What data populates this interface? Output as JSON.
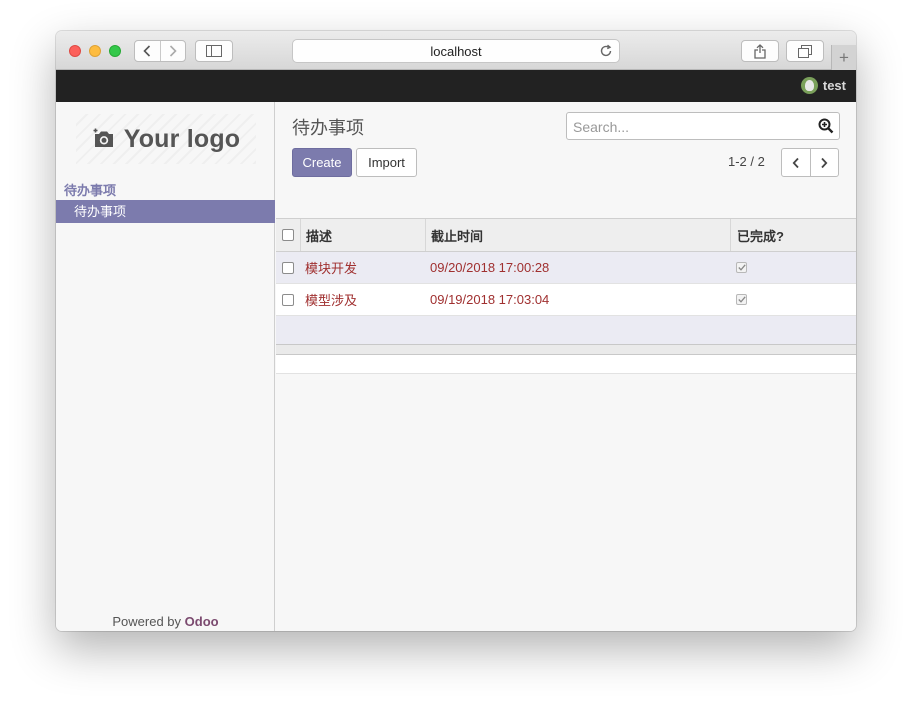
{
  "browser": {
    "url": "localhost"
  },
  "topbar": {
    "user_name": "test"
  },
  "sidebar": {
    "logo_text": "Your logo",
    "menu_header": "待办事项",
    "menu_items": [
      {
        "label": "待办事项",
        "active": true
      }
    ],
    "powered_prefix": "Powered by",
    "powered_brand": "Odoo"
  },
  "main": {
    "breadcrumb": "待办事项",
    "search_placeholder": "Search...",
    "create_label": "Create",
    "import_label": "Import",
    "pager_text": "1-2 / 2"
  },
  "table": {
    "columns": [
      "描述",
      "截止时间",
      "已完成?"
    ],
    "rows": [
      {
        "description": "模块开发",
        "deadline": "09/20/2018 17:00:28",
        "done": true
      },
      {
        "description": "模型涉及",
        "deadline": "09/19/2018 17:03:04",
        "done": true
      }
    ]
  },
  "colors": {
    "accent": "#7c7bad",
    "topbar": "#222222",
    "row_text": "#a03030"
  }
}
